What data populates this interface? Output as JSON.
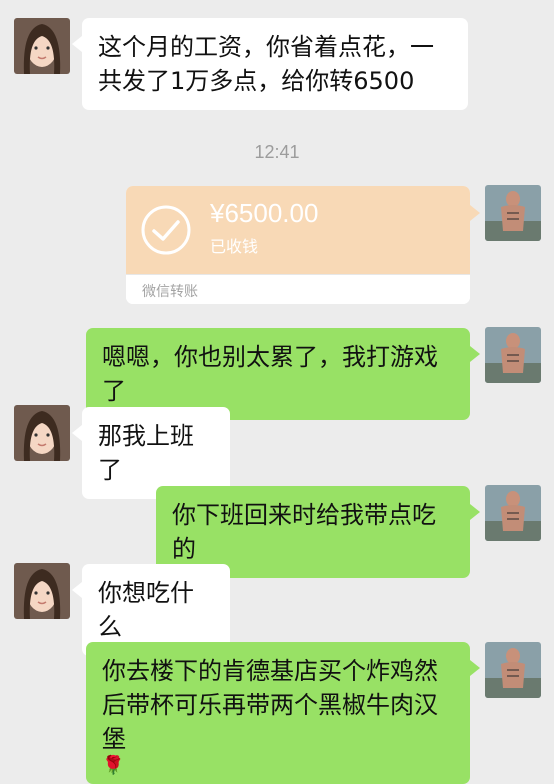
{
  "chat": {
    "messages": [
      {
        "text": "这个月的工资，你省着点花，一共发了1万多点，给你转6500"
      },
      {
        "text": "嗯嗯，你也别太累了，我打游戏了"
      },
      {
        "text": "那我上班了"
      },
      {
        "text": "你下班回来时给我带点吃的"
      },
      {
        "text": "你想吃什么"
      },
      {
        "text": "你去楼下的肯德基店买个炸鸡然后带杯可乐再带两个黑椒牛肉汉堡"
      }
    ],
    "timestamp": "12:41",
    "transfer": {
      "amount": "¥6500.00",
      "status": "已收钱",
      "label": "微信转账"
    }
  },
  "colors": {
    "background": "#ececec",
    "incoming_bubble": "#ffffff",
    "outgoing_bubble": "#98e165",
    "transfer_card": "#f8d9b6"
  },
  "icons": {
    "transfer": "check-circle-icon",
    "emoji": "rose-icon"
  }
}
